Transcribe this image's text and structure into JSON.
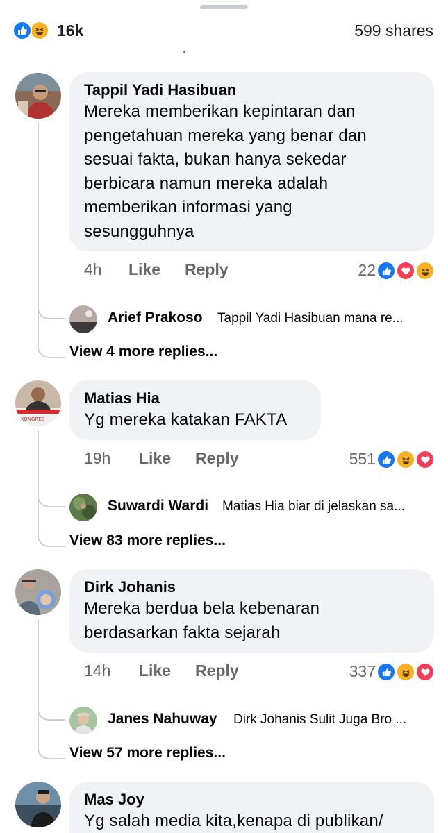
{
  "summary": {
    "reaction_count": "16k",
    "shares": "599 shares",
    "reaction_icons": [
      "like-icon",
      "haha-icon"
    ]
  },
  "colors": {
    "like": "#1877f2",
    "haha": "#f7b125",
    "love": "#f33e58",
    "bubble": "#f0f2f5",
    "meta_text": "#65676b"
  },
  "comments": [
    {
      "author": "Tappil Yadi Hasibuan",
      "lines": [
        "Mereka memberikan kepintaran dan",
        "pengetahuan mereka yang benar dan",
        "sesuai fakta, bukan hanya sekedar",
        "berbicara namun mereka adalah",
        "memberikan informasi yang",
        "sesungguhnya"
      ],
      "time": "4h",
      "like_label": "Like",
      "reply_label": "Reply",
      "reaction_count": "22",
      "reactions": [
        "like-icon",
        "love-icon",
        "haha-icon"
      ],
      "reply_preview": {
        "name": "Arief Prakoso",
        "snippet": "Tappil Yadi Hasibuan mana re..."
      },
      "more_replies": "View 4 more replies..."
    },
    {
      "author": "Matias Hia",
      "lines": [
        "Yg mereka katakan FAKTA"
      ],
      "time": "19h",
      "like_label": "Like",
      "reply_label": "Reply",
      "reaction_count": "551",
      "reactions": [
        "like-icon",
        "haha-icon",
        "love-icon"
      ],
      "reply_preview": {
        "name": "Suwardi Wardi",
        "snippet": "Matias Hia biar di jelaskan sa..."
      },
      "more_replies": "View 83 more replies..."
    },
    {
      "author": "Dirk Johanis",
      "lines": [
        "Mereka berdua bela kebenaran",
        "berdasarkan fakta sejarah"
      ],
      "time": "14h",
      "like_label": "Like",
      "reply_label": "Reply",
      "reaction_count": "337",
      "reactions": [
        "like-icon",
        "haha-icon",
        "love-icon"
      ],
      "reply_preview": {
        "name": "Janes Nahuway",
        "snippet": "Dirk Johanis Sulit Juga Bro ..."
      },
      "more_replies": "View 57 more replies..."
    },
    {
      "author": "Mas Joy",
      "lines": [
        "Yg salah media kita,kenapa di publikan/"
      ]
    }
  ]
}
